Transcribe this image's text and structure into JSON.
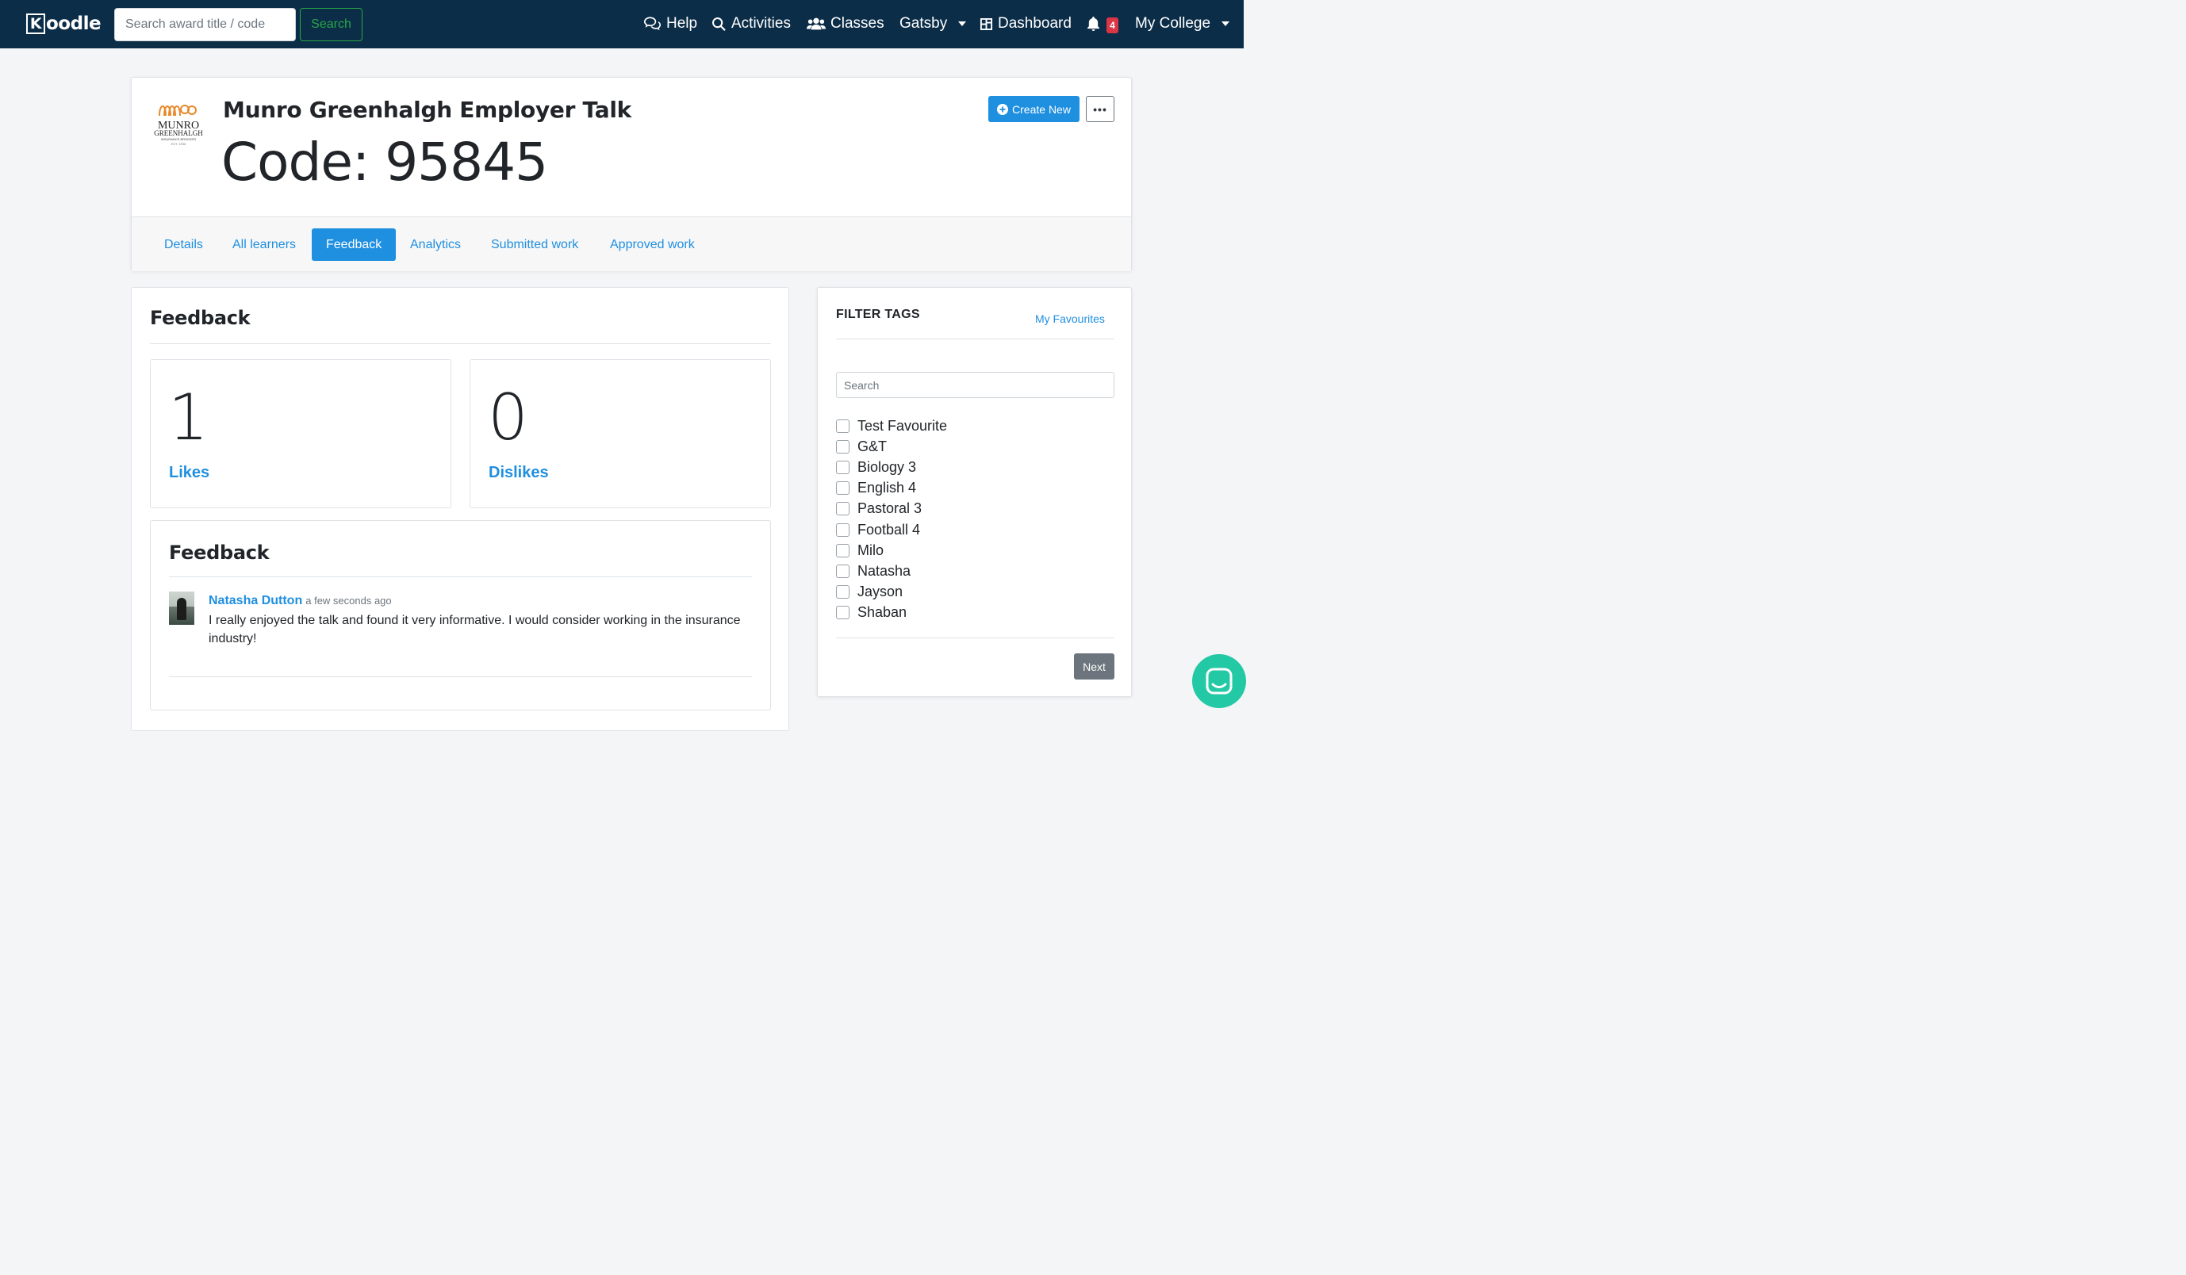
{
  "navbar": {
    "brand": "Kloodle",
    "brand_initial": "K",
    "brand_rest": "oodle",
    "search_placeholder": "Search award title / code",
    "search_button": "Search",
    "items": {
      "help": "Help",
      "activities": "Activities",
      "classes": "Classes",
      "user": "Gatsby",
      "dashboard": "Dashboard",
      "notifications_count": "4",
      "college": "My College"
    }
  },
  "header": {
    "logo_text": "MUNRO",
    "logo_subtext": "GREENHALGH",
    "logo_tagline": "INSURANCE BROKERS",
    "logo_est": "EST. 1936",
    "title": "Munro Greenhalgh Employer Talk",
    "code_label": "Code:",
    "code_value": "95845",
    "create_new": "Create New",
    "more": "•••"
  },
  "tabs": [
    {
      "label": "Details",
      "active": false
    },
    {
      "label": "All learners",
      "active": false
    },
    {
      "label": "Feedback",
      "active": true
    },
    {
      "label": "Analytics",
      "active": false
    },
    {
      "label": "Submitted work",
      "active": false
    },
    {
      "label": "Approved work",
      "active": false
    }
  ],
  "feedback": {
    "title": "Feedback",
    "likes_count": "1",
    "likes_label": "Likes",
    "dislikes_count": "0",
    "dislikes_label": "Dislikes",
    "list_title": "Feedback",
    "entries": [
      {
        "author": "Natasha Dutton",
        "time": "a few seconds ago",
        "text": "I really enjoyed the talk and found it very informative. I would consider working in the insurance industry!"
      }
    ]
  },
  "filter": {
    "title": "FILTER TAGS",
    "favourites_link": "My Favourites",
    "search_placeholder": "Search",
    "tags": [
      "Test Favourite",
      "G&T",
      "Biology 3",
      "English 4",
      "Pastoral 3",
      "Football 4",
      "Milo",
      "Natasha",
      "Jayson",
      "Shaban"
    ],
    "next_button": "Next"
  },
  "colors": {
    "navbar": "#0b2d48",
    "primary": "#1f8fe0",
    "success": "#28a745",
    "badge": "#dc3545",
    "chat": "#23c9a5",
    "logo_orange": "#e8892a"
  },
  "icons": {
    "help": "chat-bubbles-icon",
    "activities": "search-icon",
    "classes": "users-icon",
    "dashboard": "dashboard-icon",
    "notifications": "bell-icon",
    "create": "plus-circle-icon",
    "chat": "chat-widget-icon"
  }
}
